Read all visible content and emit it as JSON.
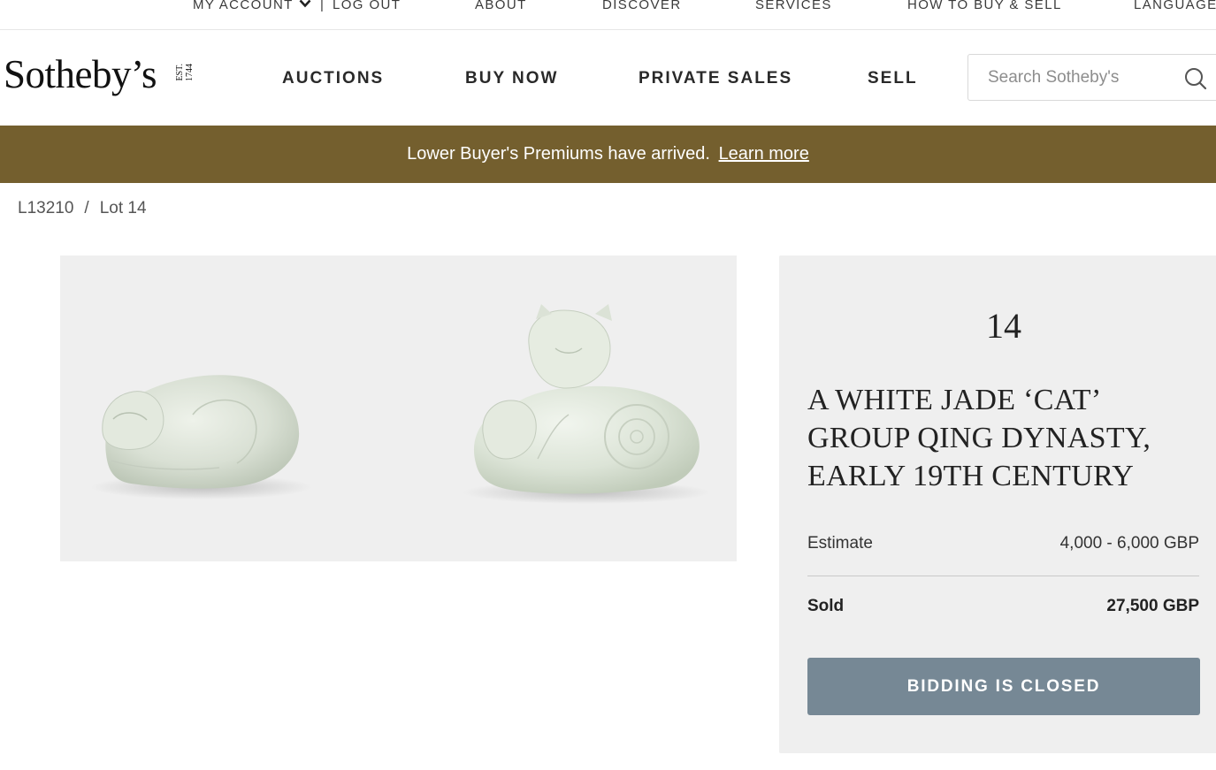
{
  "topbar": {
    "my_account": "MY ACCOUNT",
    "log_out": "LOG OUT",
    "about": "ABOUT",
    "discover": "DISCOVER",
    "services": "SERVICES",
    "how_to": "HOW TO BUY & SELL",
    "language": "LANGUAGE"
  },
  "header": {
    "logo": "Sotheby’s",
    "logo_est": "EST.",
    "logo_year": "1744",
    "nav": [
      "AUCTIONS",
      "BUY NOW",
      "PRIVATE SALES",
      "SELL"
    ],
    "search_placeholder": "Search Sotheby's"
  },
  "banner": {
    "text": "Lower Buyer's Premiums have arrived.",
    "link": "Learn more"
  },
  "breadcrumb": {
    "sale": "L13210",
    "separator": "/",
    "lot": "Lot 14"
  },
  "lot": {
    "number": "14",
    "title": "A WHITE JADE ‘CAT’ GROUP QING DYNASTY, EARLY 19TH CENTURY",
    "estimate_label": "Estimate",
    "estimate_value": "4,000 - 6,000 GBP",
    "sold_label": "Sold",
    "sold_value": "27,500 GBP",
    "button": "BIDDING IS CLOSED"
  },
  "colors": {
    "banner": "#745f2e",
    "button": "#768895",
    "card_bg": "#efefef"
  },
  "icons": [
    "chevron-down-icon",
    "search-icon"
  ]
}
